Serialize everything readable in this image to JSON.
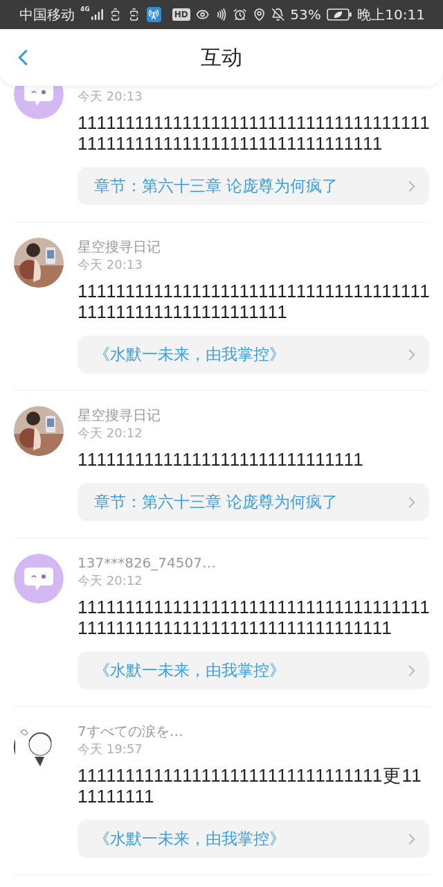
{
  "status_bar": {
    "carrier": "中国移动",
    "network": "4G",
    "hd": "HD",
    "battery": "53%",
    "time": "晚上10:11"
  },
  "header": {
    "title": "互动"
  },
  "comments": [
    {
      "avatar": {
        "kind": "bubble"
      },
      "time": "今天 20:13",
      "message": "111111111111111111111111111111111111111111111111111111111111111111111",
      "link": "章节：第六十三章 论庞尊为何疯了"
    },
    {
      "name": "星空搜寻日记",
      "time": "今天 20:13",
      "message": "11111111111111111111111111111111111111111111111111111111111",
      "link": "《水默一未来，由我掌控》"
    },
    {
      "name": "星空搜寻日记",
      "time": "今天 20:12",
      "message": "111111111111111111111111111111",
      "link": "章节：第六十三章 论庞尊为何疯了"
    },
    {
      "avatar": {
        "kind": "bubble"
      },
      "name": "137***826_74507…",
      "time": "今天 20:12",
      "message": "1111111111111111111111111111111111111111111111111111111111111111111111",
      "link": "《水默一未来，由我掌控》"
    },
    {
      "name": "7すべての涙を…",
      "time": "今天 19:57",
      "message": "11111111111111111111111111111111更1111111111",
      "link": "《水默一未来，由我掌控》"
    }
  ]
}
